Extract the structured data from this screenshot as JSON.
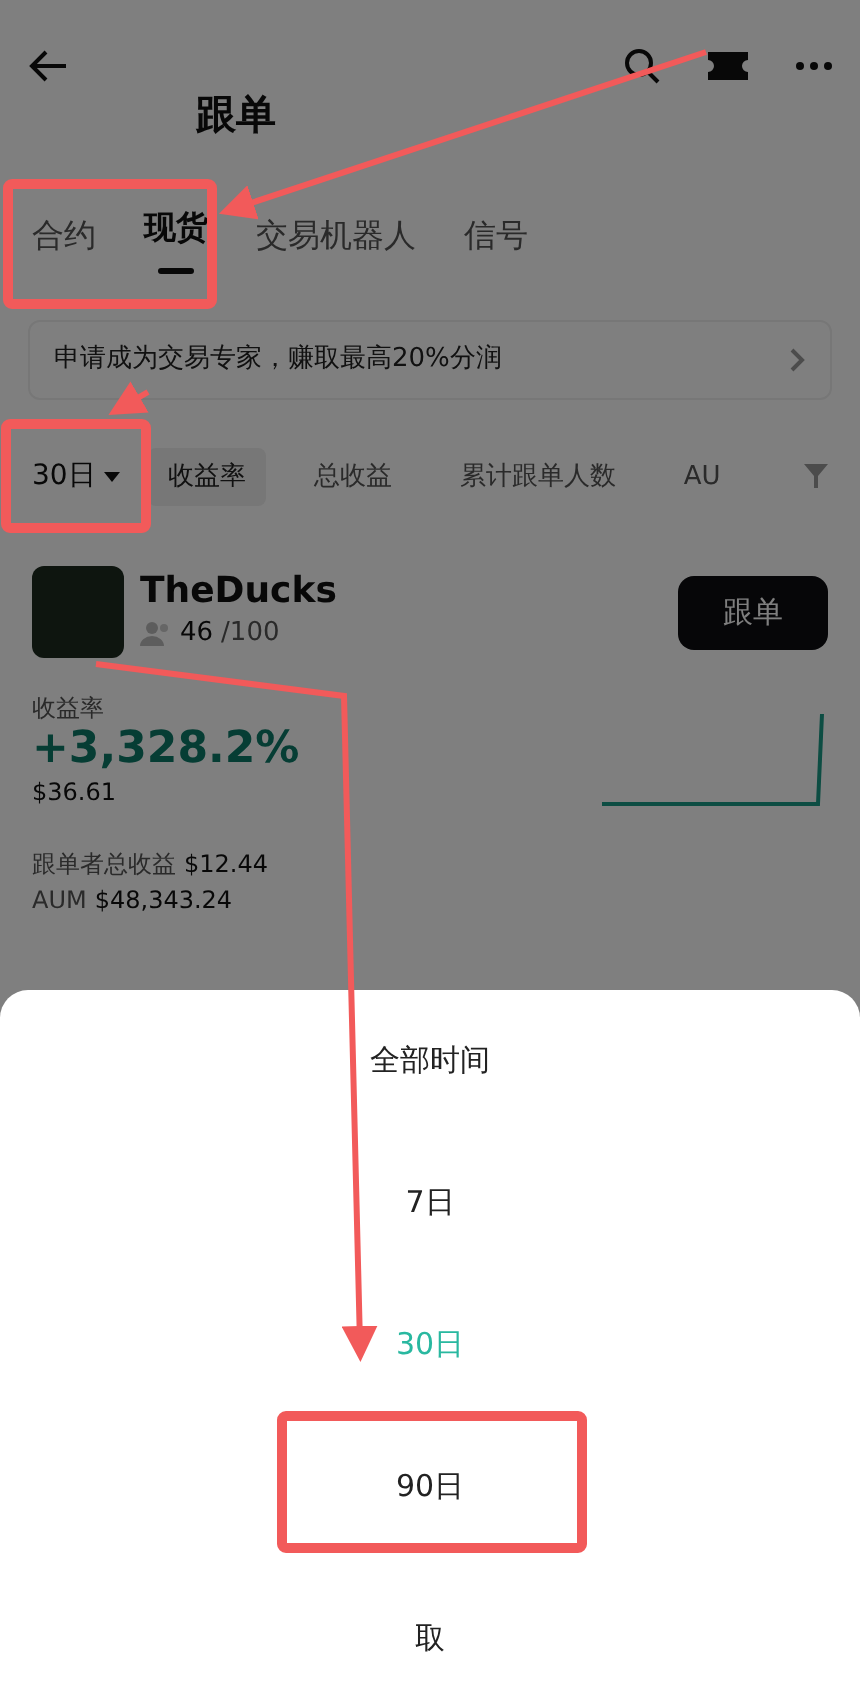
{
  "header": {
    "title": "跟单"
  },
  "tabs": [
    {
      "label": "合约",
      "selected": false
    },
    {
      "label": "现货",
      "selected": true
    },
    {
      "label": "交易机器人",
      "selected": false
    },
    {
      "label": "信号",
      "selected": false
    }
  ],
  "banner": {
    "text": "申请成为交易专家，赚取最高20%分润"
  },
  "filters": {
    "period": "30日",
    "sorts": [
      {
        "label": "收益率",
        "selected": true
      },
      {
        "label": "总收益",
        "selected": false
      },
      {
        "label": "累计跟单人数",
        "selected": false
      },
      {
        "label": "AU",
        "selected": false
      }
    ]
  },
  "trader": {
    "name": "TheDucks",
    "followers": "46",
    "capacity": "/100",
    "follow_button": "跟单",
    "roi_label": "收益率",
    "roi": "+3,328.2%",
    "pnl": "$36.61",
    "follower_pnl_label": "跟单者总收益",
    "follower_pnl": "$12.44",
    "aum_label": "AUM",
    "aum": "$48,343.24"
  },
  "sheet": {
    "options": [
      {
        "label": "全部时间",
        "selected": false
      },
      {
        "label": "7日",
        "selected": false
      },
      {
        "label": "30日",
        "selected": true
      },
      {
        "label": "90日",
        "selected": false
      }
    ],
    "cancel": "取"
  }
}
